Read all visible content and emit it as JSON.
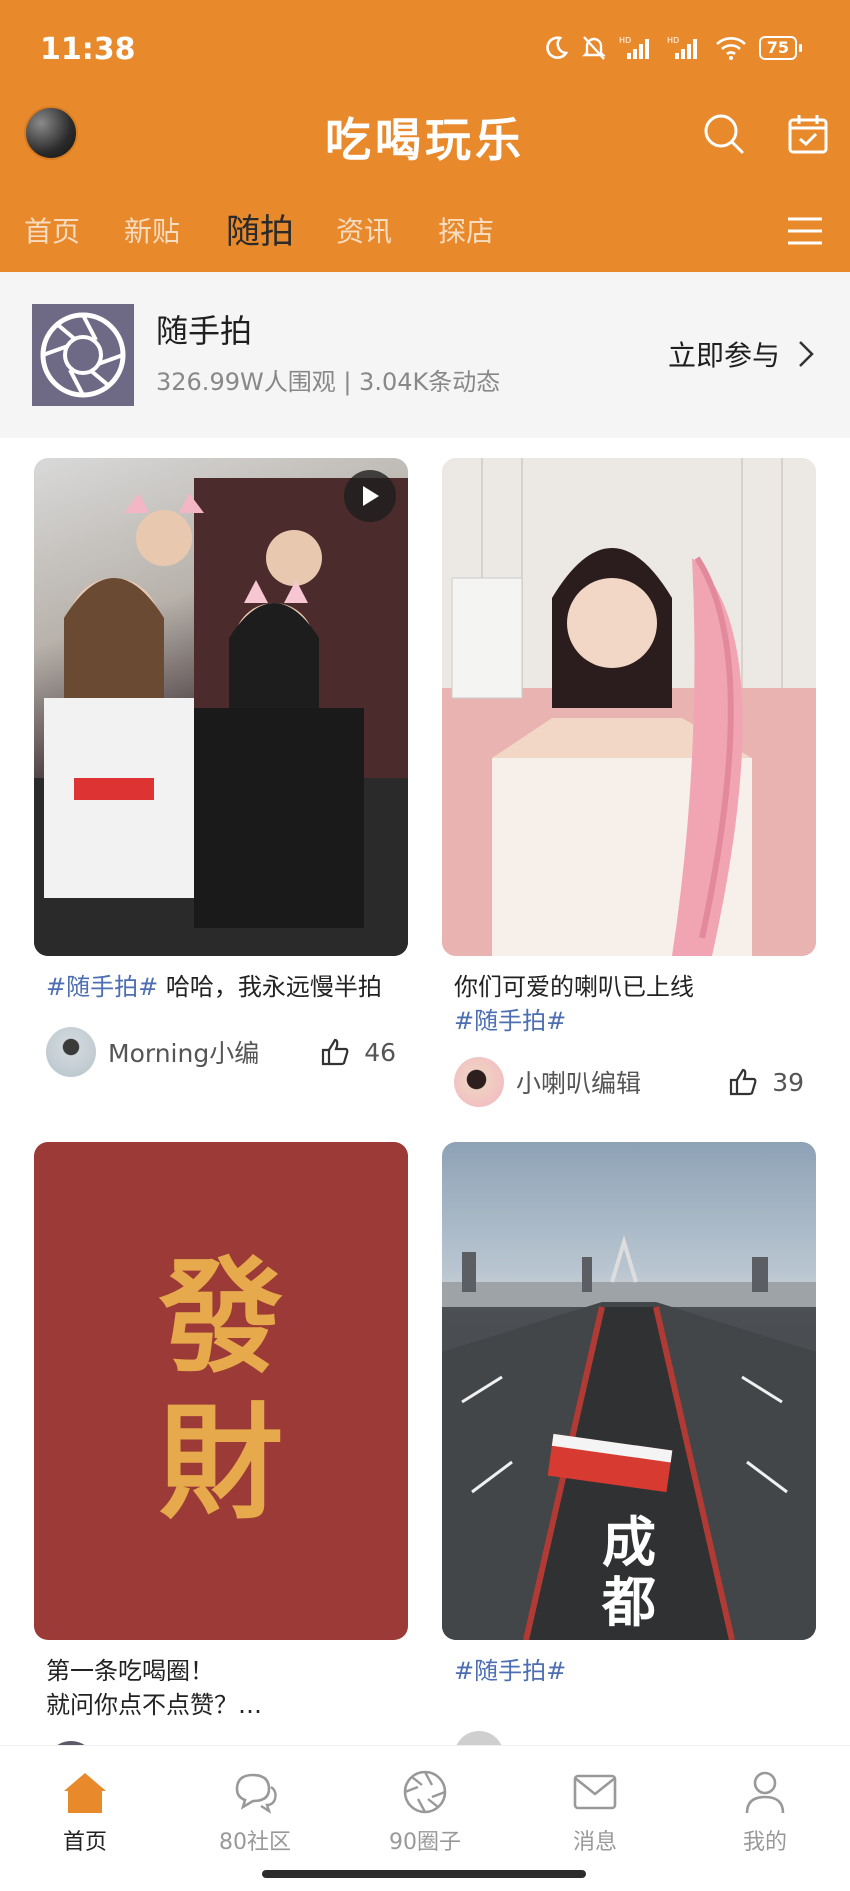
{
  "status": {
    "time": "11:38",
    "battery": "75",
    "icons": [
      "moon-icon",
      "bell-off-icon",
      "hd-signal-icon",
      "hd-signal-icon",
      "wifi-icon",
      "battery-icon"
    ]
  },
  "header": {
    "title": "吃喝玩乐",
    "accent": "#E8892C",
    "icons": [
      "search-icon",
      "calendar-icon"
    ]
  },
  "tabs": {
    "items": [
      "首页",
      "新贴",
      "随拍",
      "资讯",
      "探店"
    ],
    "active_index": 2
  },
  "topic": {
    "name": "随手拍",
    "stats": "326.99W人围观 | 3.04K条动态",
    "join_label": "立即参与"
  },
  "posts": [
    {
      "hashtag": "#随手拍#",
      "text": " 哈哈，我永远慢半拍",
      "author": "Morning小编",
      "likes": "46",
      "is_video": true
    },
    {
      "text": "你们可爱的喇叭已上线",
      "hashtag": "#随手拍#",
      "author": "小喇叭编辑",
      "likes": "39"
    },
    {
      "image_text": [
        "發",
        "財"
      ],
      "text_line1": "第一条吃喝圈！",
      "text_line2": "就问你点不点赞？…"
    },
    {
      "image_text": [
        "成",
        "都"
      ],
      "hashtag": "#随手拍#"
    }
  ],
  "bottom_nav": {
    "items": [
      "首页",
      "80社区",
      "90圈子",
      "消息",
      "我的"
    ],
    "active_index": 0
  }
}
